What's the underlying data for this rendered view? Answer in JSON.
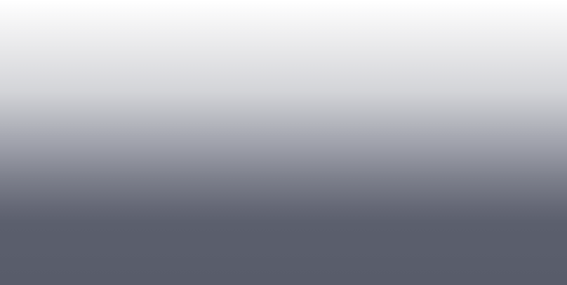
{
  "screen": {
    "colors": {
      "top": "#ffffff",
      "light_gray": "#d3d4d8",
      "mid_gray": "#9c9ea9",
      "dark_slate": "#5b5f6d",
      "bottom": "#585c6a"
    }
  }
}
